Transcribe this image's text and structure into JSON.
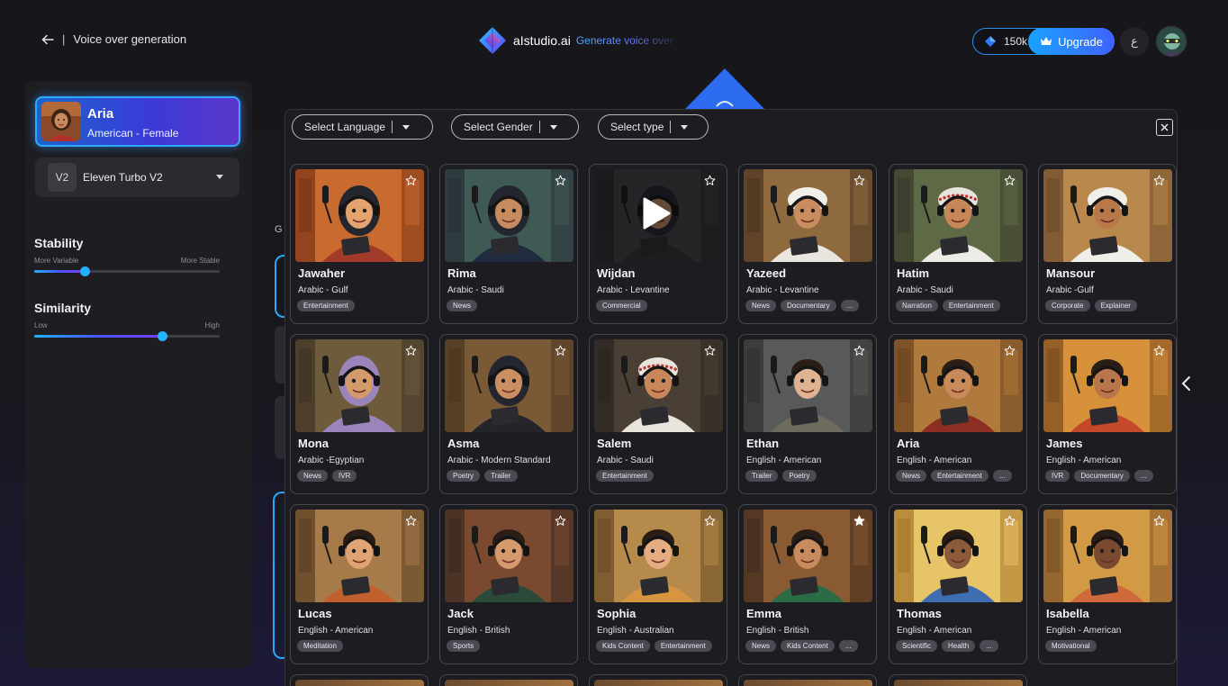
{
  "header": {
    "back_label": "Voice over generation",
    "separator": "|",
    "brand_name": "aIstudio.ai",
    "brand_tagline": "Generate voice over",
    "credits": "150k",
    "upgrade_label": "Upgrade",
    "language_toggle": "ع"
  },
  "sidebar": {
    "selected_voice": {
      "name": "Aria",
      "description": "American - Female"
    },
    "model": {
      "badge": "V2",
      "name": "Eleven Turbo V2"
    },
    "stability": {
      "title": "Stability",
      "min_label": "More Variable",
      "max_label": "More Stable",
      "value": 0.27
    },
    "similarity": {
      "title": "Similarity",
      "min_label": "Low",
      "max_label": "High",
      "value": 0.69
    }
  },
  "background": {
    "fragment_text": "G"
  },
  "modal": {
    "filters": [
      {
        "label": "Select Language"
      },
      {
        "label": "Select Gender"
      },
      {
        "label": "Select type"
      }
    ],
    "voices": [
      {
        "name": "Jawaher",
        "lang": "Arabic - Gulf",
        "tags": [
          "Entertainment"
        ],
        "starred": false,
        "playing": false,
        "palette": [
          "#c96a2e",
          "#7a3518",
          "#a23a2a",
          "#e4a470"
        ]
      },
      {
        "name": "Rima",
        "lang": "Arabic - Saudi",
        "tags": [
          "News"
        ],
        "starred": false,
        "playing": false,
        "palette": [
          "#3f5a55",
          "#2a2f36",
          "#1f2b3f",
          "#c68b5e"
        ]
      },
      {
        "name": "Wijdan",
        "lang": "Arabic - Levantine",
        "tags": [
          "Commercial"
        ],
        "starred": false,
        "playing": true,
        "palette": [
          "#3a3d3e",
          "#242628",
          "#2c2f33",
          "#a0785a"
        ]
      },
      {
        "name": "Yazeed",
        "lang": "Arabic - Levantine",
        "tags": [
          "News",
          "Documentary",
          "..."
        ],
        "starred": false,
        "playing": false,
        "palette": [
          "#8f6a3f",
          "#4a3521",
          "#e9e6e0",
          "#c98d5f"
        ]
      },
      {
        "name": "Hatim",
        "lang": "Arabic - Saudi",
        "tags": [
          "Narration",
          "Entertainment"
        ],
        "starred": false,
        "playing": false,
        "palette": [
          "#5e6a45",
          "#3b3a2b",
          "#ecebe6",
          "#c68657"
        ]
      },
      {
        "name": "Mansour",
        "lang": "Arabic -Gulf",
        "tags": [
          "Corporate",
          "Explainer"
        ],
        "starred": false,
        "playing": false,
        "palette": [
          "#b8884d",
          "#6a4a2a",
          "#f0efe9",
          "#b9784a"
        ]
      },
      {
        "name": "Mona",
        "lang": "Arabic -Egyptian",
        "tags": [
          "News",
          "IVR"
        ],
        "starred": false,
        "playing": false,
        "palette": [
          "#6e5b3c",
          "#3e3324",
          "#9a84b9",
          "#d39a6c"
        ]
      },
      {
        "name": "Asma",
        "lang": "Arabic - Modern Standard",
        "tags": [
          "Poetry",
          "Trailer"
        ],
        "starred": false,
        "playing": false,
        "palette": [
          "#7a5a36",
          "#4a3520",
          "#24252b",
          "#c98f62"
        ]
      },
      {
        "name": "Salem",
        "lang": "Arabic - Saudi",
        "tags": [
          "Entertainment"
        ],
        "starred": false,
        "playing": false,
        "palette": [
          "#4a3f34",
          "#2a2420",
          "#e8e4dc",
          "#c7875a"
        ]
      },
      {
        "name": "Ethan",
        "lang": "English - American",
        "tags": [
          "Trailer",
          "Poetry"
        ],
        "starred": false,
        "playing": false,
        "palette": [
          "#575a58",
          "#2f302f",
          "#6e6b5d",
          "#dfb291"
        ]
      },
      {
        "name": "Aria",
        "lang": "English - American",
        "tags": [
          "News",
          "Entertainment",
          "..."
        ],
        "starred": false,
        "playing": false,
        "palette": [
          "#b07a3c",
          "#6b4220",
          "#8c2f22",
          "#c88a5b"
        ]
      },
      {
        "name": "James",
        "lang": "English - American",
        "tags": [
          "IVR",
          "Documentary",
          "..."
        ],
        "starred": false,
        "playing": false,
        "palette": [
          "#d6913a",
          "#7a4a1e",
          "#c6482a",
          "#b8764a"
        ]
      },
      {
        "name": "Lucas",
        "lang": "English - American",
        "tags": [
          "Meditation"
        ],
        "starred": false,
        "playing": false,
        "palette": [
          "#a77a49",
          "#5a3e25",
          "#c0602c",
          "#e0a474"
        ]
      },
      {
        "name": "Jack",
        "lang": "English - British",
        "tags": [
          "Sports"
        ],
        "starred": false,
        "playing": false,
        "palette": [
          "#7a4a30",
          "#3a2a22",
          "#2a4a3a",
          "#d49a6e"
        ]
      },
      {
        "name": "Sophia",
        "lang": "English - Australian",
        "tags": [
          "Kids Content",
          "Entertainment"
        ],
        "starred": false,
        "playing": false,
        "palette": [
          "#b58a4a",
          "#6a4a26",
          "#d89540",
          "#e6ad82"
        ]
      },
      {
        "name": "Emma",
        "lang": "English - British",
        "tags": [
          "News",
          "Kids Content",
          "..."
        ],
        "starred": true,
        "playing": false,
        "palette": [
          "#8a5a32",
          "#3f2a1c",
          "#2b6b45",
          "#c88b5e"
        ]
      },
      {
        "name": "Thomas",
        "lang": "English - American",
        "tags": [
          "Scientific",
          "Health",
          "..."
        ],
        "starred": false,
        "playing": false,
        "palette": [
          "#e8c468",
          "#a5762a",
          "#3e6db0",
          "#8a5a3a"
        ]
      },
      {
        "name": "Isabella",
        "lang": "English - American",
        "tags": [
          "Motivational"
        ],
        "starred": false,
        "playing": false,
        "palette": [
          "#d39a46",
          "#7a5024",
          "#d06a3a",
          "#7a4a30"
        ]
      }
    ]
  },
  "colors": {
    "accent": "#1aa2ff",
    "accent2": "#3f63ff",
    "panel": "#1e1e22",
    "modal": "#1c1c21"
  }
}
